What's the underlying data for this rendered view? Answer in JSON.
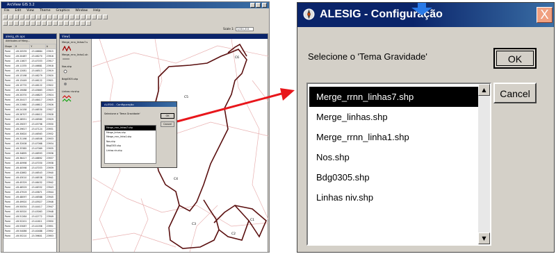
{
  "app": {
    "title": "ArcView GIS 3.2",
    "menu": [
      "File",
      "Edit",
      "View",
      "Theme",
      "Graphics",
      "Window",
      "Help"
    ],
    "scale_label": "Scale 1:",
    "scale_value": "1,011,211",
    "table_window": {
      "title": "alesig_shi.aps",
      "subtitle": "Attributes of Merg...",
      "columns": [
        "Shape",
        "X",
        "Y",
        "A"
      ],
      "rows": [
        [
          "Point",
          "-49.20539",
          "-15.46684",
          "23915"
        ],
        [
          "Point",
          "-49.20487",
          "-15.46270",
          "23916"
        ],
        [
          "Point",
          "-49.11607",
          "-15.47033",
          "23917"
        ],
        [
          "Point",
          "-49.11335",
          "-15.46681",
          "23918"
        ],
        [
          "Point",
          "-49.12081",
          "-15.46513",
          "23919"
        ],
        [
          "Point",
          "-49.13198",
          "-15.46279",
          "23920"
        ],
        [
          "Point",
          "-49.13449",
          "-15.46122",
          "23921"
        ],
        [
          "Point",
          "-49.15770",
          "-15.46122",
          "23922"
        ],
        [
          "Point",
          "-49.19088",
          "-15.45663",
          "23923"
        ],
        [
          "Point",
          "-49.20370",
          "-15.46823",
          "23924"
        ],
        [
          "Point",
          "-49.20417",
          "-15.46417",
          "23925"
        ],
        [
          "Point",
          "-49.21980",
          "-15.46612",
          "23926"
        ],
        [
          "Point",
          "-49.24158",
          "-15.46530",
          "23927"
        ],
        [
          "Point",
          "-49.26707",
          "-15.46412",
          "23928"
        ],
        [
          "Point",
          "-49.28551",
          "-15.46580",
          "23929"
        ],
        [
          "Point",
          "-49.29057",
          "-15.45798",
          "23930"
        ],
        [
          "Point",
          "-49.29617",
          "-15.47124",
          "23931"
        ],
        [
          "Point",
          "-49.30620",
          "-15.46563",
          "23932"
        ],
        [
          "Point",
          "-49.31198",
          "-15.46508",
          "23933"
        ],
        [
          "Point",
          "-49.32008",
          "-15.47068",
          "23934"
        ],
        [
          "Point",
          "-49.33385",
          "-15.47069",
          "23935"
        ],
        [
          "Point",
          "-49.34895",
          "-15.46593",
          "23936"
        ],
        [
          "Point",
          "-49.36417",
          "-15.46692",
          "23937"
        ],
        [
          "Point",
          "-49.40998",
          "-15.47030",
          "23938"
        ],
        [
          "Point",
          "-49.40598",
          "-15.47033",
          "23939"
        ],
        [
          "Point",
          "-49.42862",
          "-15.46543",
          "23940"
        ],
        [
          "Point",
          "-49.43010",
          "-15.46538",
          "23941"
        ],
        [
          "Point",
          "-49.45329",
          "-15.46432",
          "23942"
        ],
        [
          "Point",
          "-49.46529",
          "-15.46332",
          "23943"
        ],
        [
          "Point",
          "-49.47919",
          "-15.45871",
          "23944"
        ],
        [
          "Point",
          "-49.48097",
          "-15.46588",
          "23945"
        ],
        [
          "Point",
          "-49.49920",
          "-15.45927",
          "23946"
        ],
        [
          "Point",
          "-49.50054",
          "-15.44417",
          "23947"
        ],
        [
          "Point",
          "-49.50520",
          "-15.43063",
          "23948"
        ],
        [
          "Point",
          "-49.51264",
          "-15.42772",
          "23949"
        ],
        [
          "Point",
          "-49.52201",
          "-15.41611",
          "23950"
        ],
        [
          "Point",
          "-49.53087",
          "-15.41056",
          "23951"
        ],
        [
          "Point",
          "-49.54086",
          "-15.40488",
          "23952"
        ],
        [
          "Point",
          "-49.55210",
          "-15.39601",
          "23953"
        ]
      ]
    },
    "view_window": {
      "title": "View1",
      "legend": [
        "Merge_rrnn_linhas7.s",
        "Merge_rrnn_linha1.sh",
        "Nos.shp",
        "Bdg0305.shp",
        "Linhas niv.shp"
      ],
      "map_labels": [
        "C6",
        "C5",
        "C4",
        "C3",
        "C2",
        "C1"
      ]
    },
    "mini_dialog": {
      "title": "ALESIG - Configuração",
      "prompt": "Selecione o 'Tema Gravidade'",
      "items": [
        "Merge_rrnn_linhas7.shp",
        "Merge_linhas.shp",
        "Merge_rrnn_linha1.shp",
        "Nos.shp",
        "Bdg0305.shp",
        "Linhas niv.shp"
      ],
      "ok": "OK",
      "cancel": "Cancel"
    }
  },
  "dialog": {
    "title": "ALESIG - Configuração",
    "prompt": "Selecione o 'Tema Gravidade'",
    "items": [
      "Merge_rrnn_linhas7.shp",
      "Merge_linhas.shp",
      "Merge_rrnn_linha1.shp",
      "Nos.shp",
      "Bdg0305.shp",
      "Linhas niv.shp"
    ],
    "selected_index": 0,
    "ok_label": "OK",
    "cancel_label": "Cancel",
    "close_glyph": "X",
    "scroll_up_glyph": "▲",
    "scroll_down_glyph": "▼"
  },
  "colors": {
    "title_bar": "#0a246a",
    "arrow": "#e8161b",
    "map_boundary": "#5a0f0f",
    "map_roads": "#e8b0b0"
  },
  "icons": [
    "arcview-logo-icon",
    "down-arrow-icon",
    "close-icon",
    "scroll-up-icon",
    "scroll-down-icon"
  ]
}
